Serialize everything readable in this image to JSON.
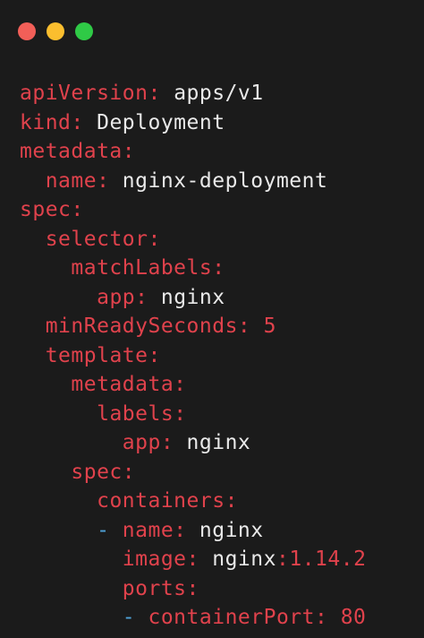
{
  "window": {
    "controls": [
      {
        "name": "close",
        "color": "#f25f58"
      },
      {
        "name": "minimize",
        "color": "#fbbe2e"
      },
      {
        "name": "maximize",
        "color": "#2fca46"
      }
    ]
  },
  "code": {
    "lines": [
      {
        "indent": "",
        "key": "apiVersion",
        "sep": ": ",
        "value": "apps/v1"
      },
      {
        "indent": "",
        "key": "kind",
        "sep": ": ",
        "value": "Deployment"
      },
      {
        "indent": "",
        "key": "metadata",
        "sep": ":",
        "value": ""
      },
      {
        "indent": "  ",
        "key": "name",
        "sep": ": ",
        "value": "nginx-deployment"
      },
      {
        "indent": "",
        "key": "spec",
        "sep": ":",
        "value": ""
      },
      {
        "indent": "  ",
        "key": "selector",
        "sep": ":",
        "value": ""
      },
      {
        "indent": "    ",
        "key": "matchLabels",
        "sep": ":",
        "value": ""
      },
      {
        "indent": "      ",
        "key": "app",
        "sep": ": ",
        "value": "nginx"
      },
      {
        "indent": "  ",
        "key": "minReadySeconds",
        "sep": ": ",
        "number": "5"
      },
      {
        "indent": "  ",
        "key": "template",
        "sep": ":",
        "value": ""
      },
      {
        "indent": "    ",
        "key": "metadata",
        "sep": ":",
        "value": ""
      },
      {
        "indent": "      ",
        "key": "labels",
        "sep": ":",
        "value": ""
      },
      {
        "indent": "        ",
        "key": "app",
        "sep": ": ",
        "value": "nginx"
      },
      {
        "indent": "    ",
        "key": "spec",
        "sep": ":",
        "value": ""
      },
      {
        "indent": "      ",
        "key": "containers",
        "sep": ":",
        "value": ""
      },
      {
        "indent": "      ",
        "dash": "- ",
        "key": "name",
        "sep": ": ",
        "value": "nginx"
      },
      {
        "indent": "        ",
        "key": "image",
        "sep": ": ",
        "value": "nginx",
        "value_sep": ":",
        "number": "1.14.2"
      },
      {
        "indent": "        ",
        "key": "ports",
        "sep": ":",
        "value": ""
      },
      {
        "indent": "        ",
        "dash": "- ",
        "key": "containerPort",
        "sep": ": ",
        "number": "80"
      }
    ]
  },
  "colors": {
    "background": "#1b1b1b",
    "key": "#e0424c",
    "value": "#e9e9e9",
    "number": "#e0424c",
    "dash": "#4fa3d9"
  }
}
